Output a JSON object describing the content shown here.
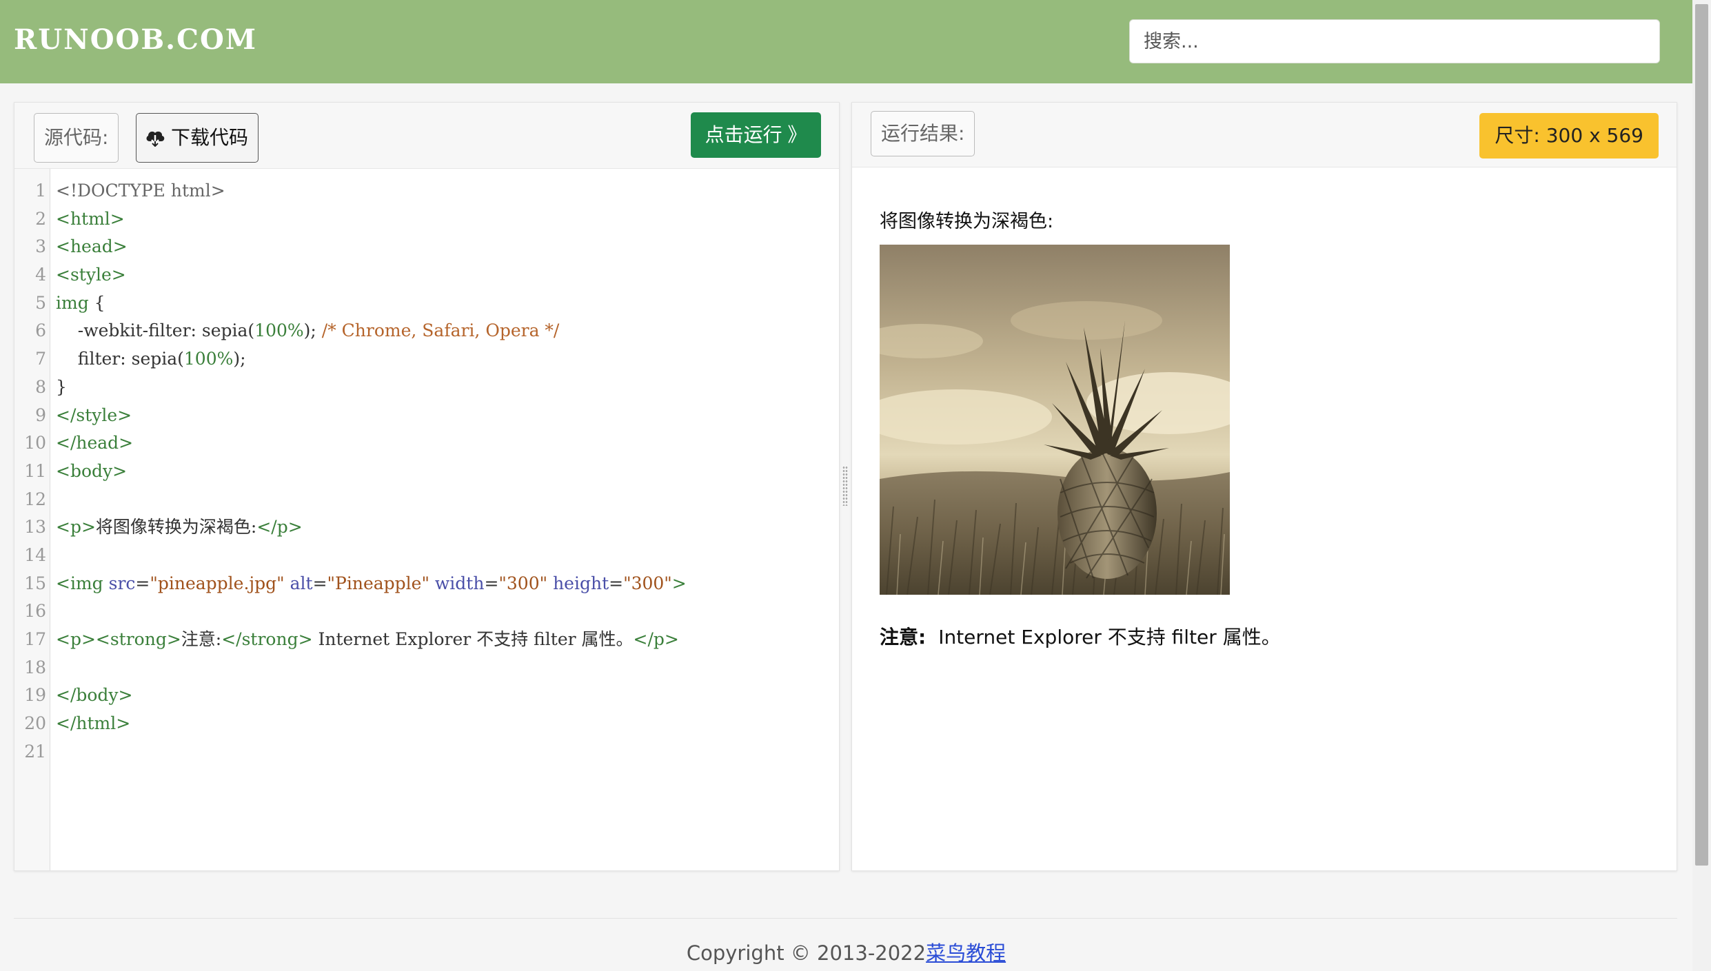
{
  "header": {
    "logo": "RUNOOB.COM",
    "search_placeholder": "搜索..."
  },
  "left_panel": {
    "source_label": "源代码:",
    "download_label": "下载代码",
    "run_label": "点击运行 》",
    "code_lines": [
      {
        "n": "1",
        "segs": [
          [
            "meta",
            "<!DOCTYPE html>"
          ]
        ]
      },
      {
        "n": "2",
        "segs": [
          [
            "tag",
            "<html>"
          ]
        ]
      },
      {
        "n": "3",
        "segs": [
          [
            "tag",
            "<head>"
          ]
        ]
      },
      {
        "n": "4",
        "segs": [
          [
            "tag",
            "<style>"
          ]
        ]
      },
      {
        "n": "5",
        "segs": [
          [
            "tag",
            "img"
          ],
          [
            "plain",
            " {"
          ]
        ]
      },
      {
        "n": "6",
        "segs": [
          [
            "plain",
            "    -webkit-filter: sepia("
          ],
          [
            "num",
            "100%"
          ],
          [
            "plain",
            "); "
          ],
          [
            "com",
            "/* Chrome, Safari, Opera */"
          ]
        ]
      },
      {
        "n": "7",
        "segs": [
          [
            "plain",
            "    filter: sepia("
          ],
          [
            "num",
            "100%"
          ],
          [
            "plain",
            ");"
          ]
        ]
      },
      {
        "n": "8",
        "segs": [
          [
            "plain",
            "}"
          ]
        ]
      },
      {
        "n": "9",
        "segs": [
          [
            "tag",
            "</style>"
          ]
        ]
      },
      {
        "n": "10",
        "segs": [
          [
            "tag",
            "</head>"
          ]
        ]
      },
      {
        "n": "11",
        "segs": [
          [
            "tag",
            "<body>"
          ]
        ]
      },
      {
        "n": "12",
        "segs": []
      },
      {
        "n": "13",
        "segs": [
          [
            "tag",
            "<p>"
          ],
          [
            "plain",
            "将图像转换为深褐色:"
          ],
          [
            "tag",
            "</p>"
          ]
        ]
      },
      {
        "n": "14",
        "segs": []
      },
      {
        "n": "15",
        "segs": [
          [
            "tag",
            "<img "
          ],
          [
            "attr",
            "src"
          ],
          [
            "plain",
            "="
          ],
          [
            "str",
            "\"pineapple.jpg\""
          ],
          [
            "plain",
            " "
          ],
          [
            "attr",
            "alt"
          ],
          [
            "plain",
            "="
          ],
          [
            "str",
            "\"Pineapple\""
          ],
          [
            "plain",
            " "
          ],
          [
            "attr",
            "width"
          ],
          [
            "plain",
            "="
          ],
          [
            "str",
            "\"300\""
          ],
          [
            "plain",
            " "
          ],
          [
            "attr",
            "height"
          ],
          [
            "plain",
            "="
          ],
          [
            "str",
            "\"300\""
          ],
          [
            "tag",
            ">"
          ]
        ]
      },
      {
        "n": "16",
        "segs": []
      },
      {
        "n": "17",
        "segs": [
          [
            "tag",
            "<p><strong>"
          ],
          [
            "plain",
            "注意:"
          ],
          [
            "tag",
            "</strong>"
          ],
          [
            "plain",
            " Internet Explorer 不支持 filter 属性。"
          ],
          [
            "tag",
            "</p>"
          ]
        ]
      },
      {
        "n": "18",
        "segs": []
      },
      {
        "n": "19",
        "segs": [
          [
            "tag",
            "</body>"
          ]
        ]
      },
      {
        "n": "20",
        "segs": [
          [
            "tag",
            "</html>"
          ]
        ]
      },
      {
        "n": "21",
        "segs": []
      }
    ]
  },
  "right_panel": {
    "result_label": "运行结果:",
    "size_badge": "尺寸: 300 x 569",
    "paragraph": "将图像转换为深褐色:",
    "note_strong": "注意:",
    "note_text": "Internet Explorer 不支持 filter 属性。"
  },
  "footer": {
    "copyright": "Copyright © 2013-2022",
    "link": "菜鸟教程"
  },
  "colors": {
    "header_bg": "#96bb7c",
    "run_button": "#1f8a4c",
    "size_badge": "#f9c22e",
    "link": "#2a4cd6"
  },
  "icons": {
    "download": "cloud-download-icon"
  }
}
